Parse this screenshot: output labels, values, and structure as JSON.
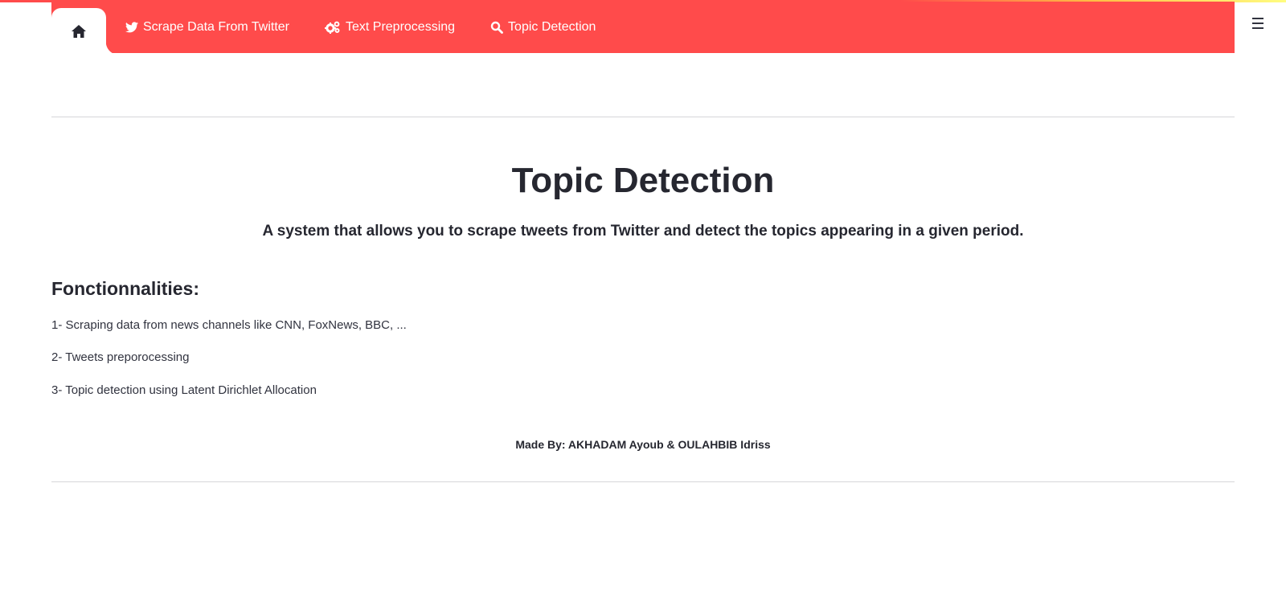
{
  "colors": {
    "accent": "#ff4b4b",
    "text": "#262730",
    "divider": "#d6d6d9"
  },
  "app_menu": {
    "icon": "hamburger-menu-icon"
  },
  "navbar": {
    "home": {
      "icon": "home-icon"
    },
    "items": [
      {
        "label": "Scrape Data From Twitter",
        "icon": "twitter-icon"
      },
      {
        "label": "Text Preprocessing",
        "icon": "gears-icon"
      },
      {
        "label": "Topic Detection",
        "icon": "search-icon"
      }
    ]
  },
  "main": {
    "title": "Topic Detection",
    "subtitle": "A system that allows you to scrape tweets from Twitter and detect the topics appearing in a given period.",
    "section_heading": "Fonctionnalities:",
    "features": [
      "1- Scraping data from news channels like CNN, FoxNews, BBC, ...",
      "2- Tweets preporocessing",
      "3- Topic detection using Latent Dirichlet Allocation"
    ],
    "credits": "Made By: AKHADAM Ayoub & OULAHBIB Idriss"
  }
}
